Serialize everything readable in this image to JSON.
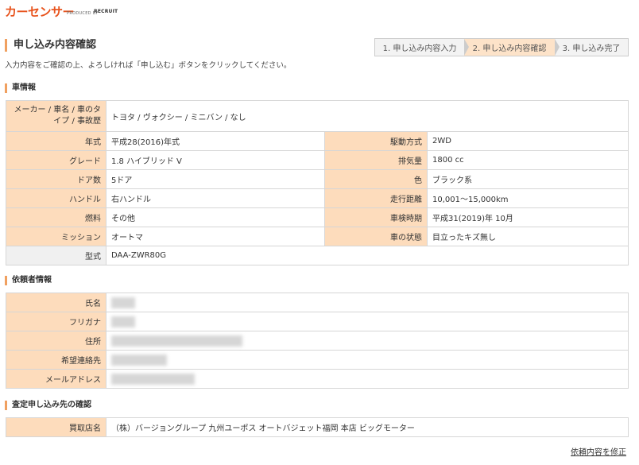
{
  "brand": {
    "logo": "カーセンサー",
    "produced_by": "PRODUCED BY",
    "recruit": "RECRUIT"
  },
  "page": {
    "title": "申し込み内容確認",
    "intro": "入力内容をご確認の上、よろしければ「申し込む」ボタンをクリックしてください。"
  },
  "steps": [
    "1. 申し込み内容入力",
    "2. 申し込み内容確認",
    "3. 申し込み完了"
  ],
  "car_section": {
    "title": "車情報",
    "maker_label": "メーカー / 車名 / 車のタイプ / 事故歴",
    "maker_value": "トヨタ / ヴォクシー / ミニバン / なし",
    "rows": [
      {
        "l1": "年式",
        "v1": "平成28(2016)年式",
        "l2": "駆動方式",
        "v2": "2WD"
      },
      {
        "l1": "グレード",
        "v1": "1.8 ハイブリッド V",
        "l2": "排気量",
        "v2": "1800 cc"
      },
      {
        "l1": "ドア数",
        "v1": "5ドア",
        "l2": "色",
        "v2": "ブラック系"
      },
      {
        "l1": "ハンドル",
        "v1": "右ハンドル",
        "l2": "走行距離",
        "v2": "10,001～15,000km"
      },
      {
        "l1": "燃料",
        "v1": "その他",
        "l2": "車検時期",
        "v2": "平成31(2019)年 10月"
      },
      {
        "l1": "ミッション",
        "v1": "オートマ",
        "l2": "車の状態",
        "v2": "目立ったキズ無し"
      }
    ],
    "model_label": "型式",
    "model_value": "DAA-ZWR80G"
  },
  "requester_section": {
    "title": "依頼者情報",
    "labels": [
      "氏名",
      "フリガナ",
      "住所",
      "希望連絡先",
      "メールアドレス"
    ]
  },
  "dest_section": {
    "title": "査定申し込み先の確認",
    "label": "買取店名",
    "value": "（株）バージョングループ 九州ユーポス オートバジェット福岡 本店 ビッグモーター"
  },
  "fix_link": "依頼内容を修正",
  "colors": {
    "accent": "#e8541e",
    "label_bg": "#fddcbc",
    "section_bar": "#f0a060"
  }
}
